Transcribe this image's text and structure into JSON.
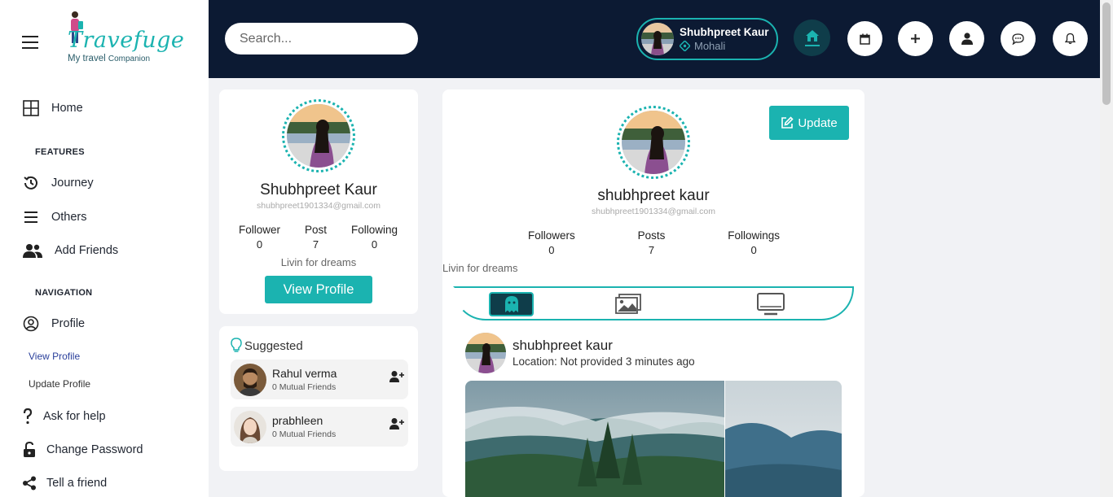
{
  "sidebar": {
    "logo_title": "Travefuge",
    "logo_subtitle_a": "My travel",
    "logo_subtitle_b": "Companion",
    "home": "Home",
    "features_heading": "FEATURES",
    "journey": "Journey",
    "others": "Others",
    "add_friends": "Add Friends",
    "navigation_heading": "NAVIGATION",
    "profile": "Profile",
    "view_profile": "View Profile",
    "update_profile": "Update Profile",
    "ask_help": "Ask for help",
    "change_password": "Change Password",
    "tell_friend": "Tell a friend",
    "active_sub_color": "#2a3f9b"
  },
  "header": {
    "search_placeholder": "Search...",
    "user_name": "Shubhpreet Kaur",
    "user_location": "Mohali",
    "icons": [
      "home-icon",
      "calendar-icon",
      "plus-icon",
      "user-icon",
      "chat-icon",
      "bell-icon"
    ]
  },
  "profile_card": {
    "name": "Shubhpreet Kaur",
    "email": "shubhpreet1901334@gmail.com",
    "follower_label": "Follower",
    "follower_count": "0",
    "post_label": "Post",
    "post_count": "7",
    "following_label": "Following",
    "following_count": "0",
    "bio": "Livin for dreams",
    "view_profile_button": "View Profile"
  },
  "suggested": {
    "title": "Suggested",
    "people": [
      {
        "name": "Rahul verma",
        "mutual": "0 Mutual Friends"
      },
      {
        "name": "prabhleen",
        "mutual": "0 Mutual Friends"
      }
    ]
  },
  "main": {
    "update_button": "Update",
    "name": "shubhpreet kaur",
    "email": "shubhpreet1901334@gmail.com",
    "followers_label": "Followers",
    "followers_count": "0",
    "posts_label": "Posts",
    "posts_count": "7",
    "followings_label": "Followings",
    "followings_count": "0",
    "bio": "Livin for dreams",
    "tabs": [
      "ghost-icon",
      "images-icon",
      "monitor-icon"
    ],
    "post": {
      "author": "shubhpreet kaur",
      "meta": "Location: Not provided 3 minutes ago"
    }
  },
  "colors": {
    "accent": "#1bb3b0",
    "header_bg": "#0c1a33",
    "active_tab": "#0f3d4a"
  }
}
